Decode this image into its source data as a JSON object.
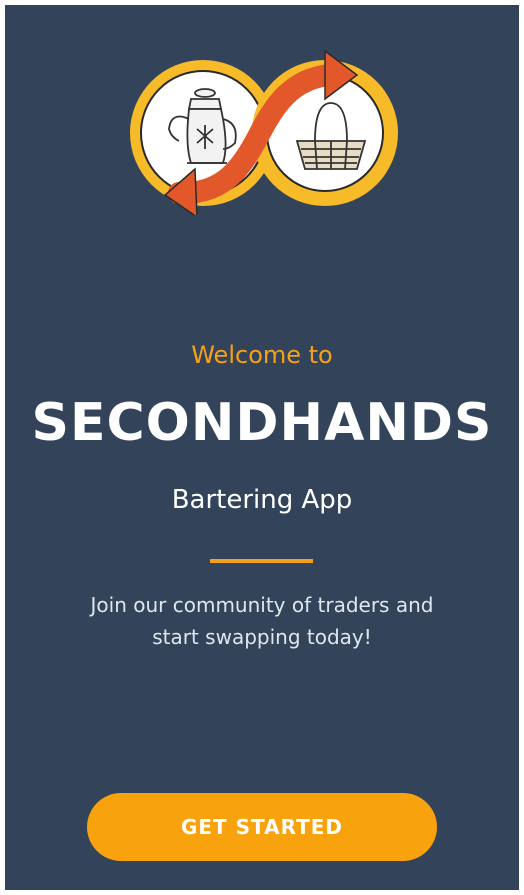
{
  "logo": {
    "icon": "barter-exchange-logo",
    "left_item": "teapot-icon",
    "right_item": "basket-icon"
  },
  "welcome": {
    "text": "Welcome to"
  },
  "app": {
    "name": "SECONDHANDS",
    "tagline": "Bartering App"
  },
  "description": {
    "line1": "Join our community of traders and",
    "line2": "start swapping today!"
  },
  "cta": {
    "label": "GET STARTED"
  },
  "colors": {
    "background": "#33445a",
    "accent": "#f8a30e",
    "arrow": "#e2582a",
    "text": "#ffffff"
  }
}
